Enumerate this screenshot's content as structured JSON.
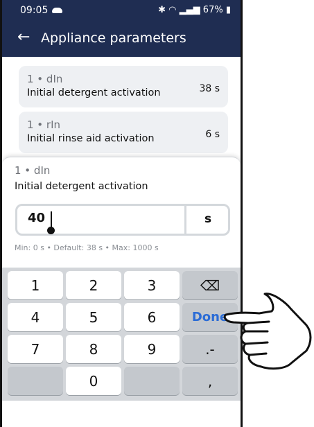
{
  "status_bar": {
    "time": "09:05",
    "battery_text": "67%"
  },
  "app_bar": {
    "title": "Appliance parameters"
  },
  "parameters": [
    {
      "code": "1 • dIn",
      "name": "Initial detergent activation",
      "value": "38 s"
    },
    {
      "code": "1 • rIn",
      "name": "Initial rinse aid activation",
      "value": "6 s"
    }
  ],
  "editor": {
    "code": "1 • dIn",
    "name": "Initial detergent activation",
    "input_value": "40",
    "unit": "s",
    "hint": "Min: 0 s • Default: 38 s • Max: 1000 s"
  },
  "keypad": {
    "keys": [
      "1",
      "2",
      "3",
      "4",
      "5",
      "6",
      "7",
      "8",
      "9",
      "0"
    ],
    "done_label": "Done",
    "decimal_label": ".-",
    "comma_label": ","
  },
  "icons": {
    "back": "arrow-left-icon",
    "backspace": "backspace-icon",
    "hand": "pointing-hand-icon"
  }
}
